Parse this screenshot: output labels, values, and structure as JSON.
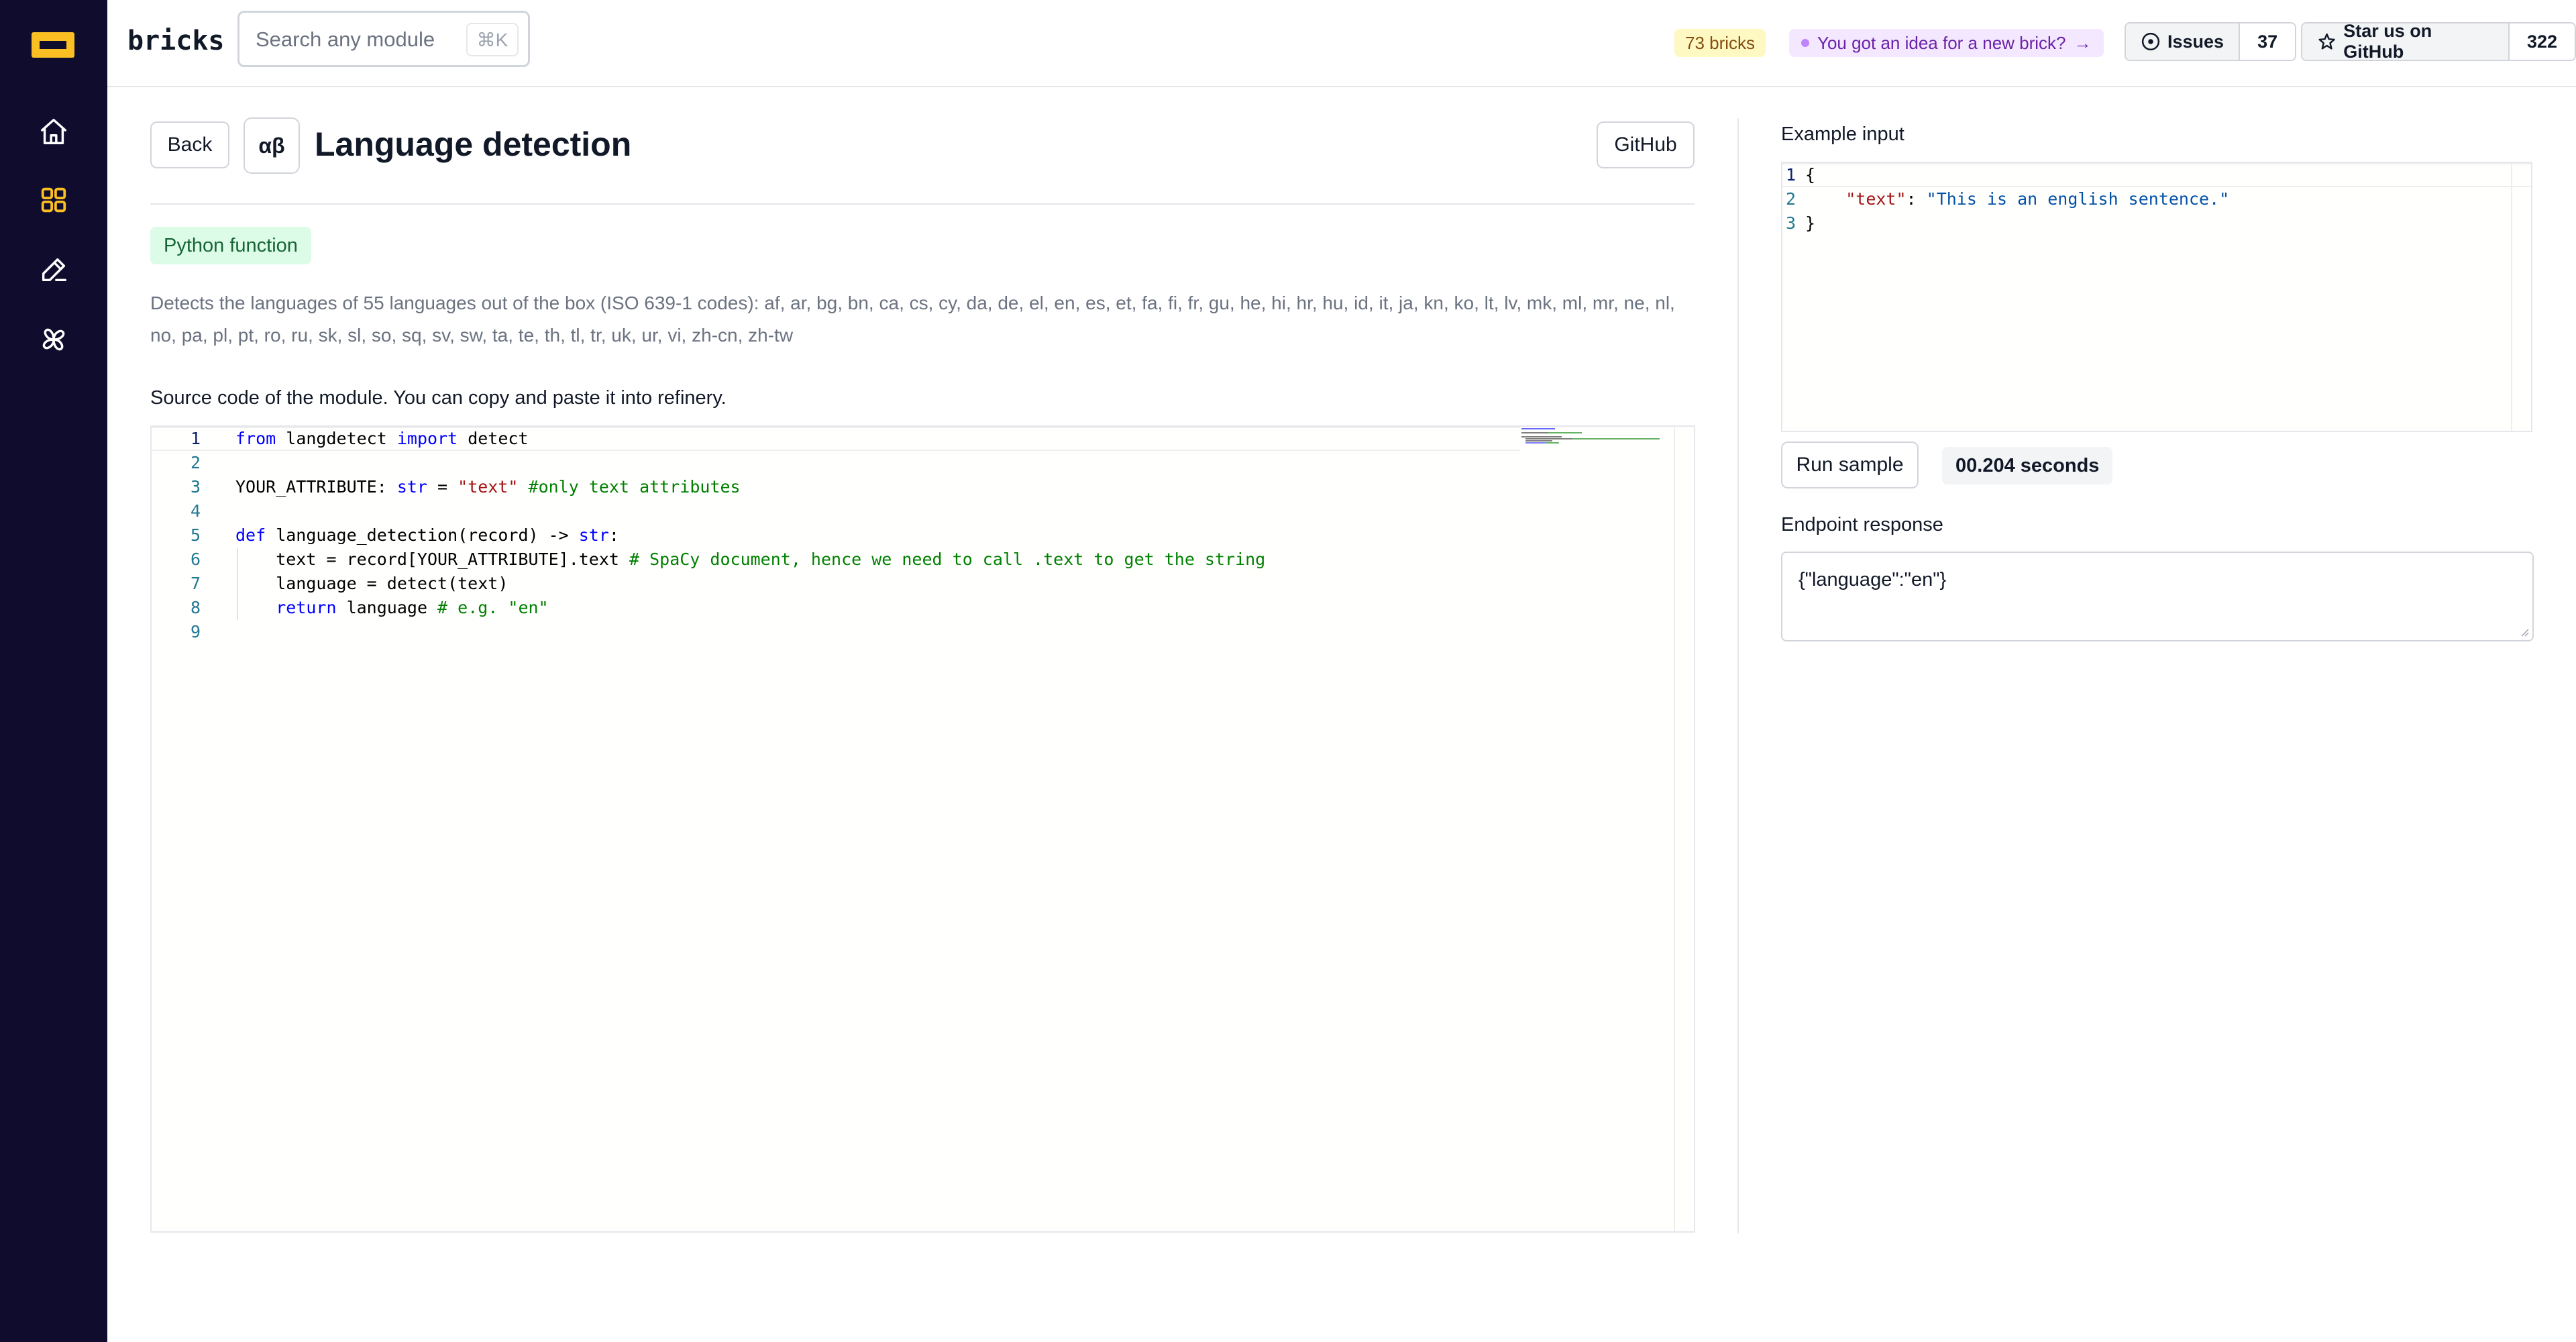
{
  "app": {
    "brand": "bricks",
    "search_placeholder": "Search any module",
    "search_shortcut": "⌘K"
  },
  "topbar": {
    "bricks_count": "73 bricks",
    "idea_text": "You got an idea for a new brick?",
    "idea_arrow": "→",
    "issues_label": "Issues",
    "issues_count": "37",
    "star_label": "Star us on GitHub",
    "star_count": "322"
  },
  "sidebar": {
    "items": [
      {
        "icon": "home-icon"
      },
      {
        "icon": "modules-grid-icon"
      },
      {
        "icon": "pen-edit-icon"
      },
      {
        "icon": "pinwheel-icon"
      }
    ]
  },
  "module": {
    "back_label": "Back",
    "icon_glyph": "αβ",
    "title": "Language detection",
    "github_label": "GitHub",
    "tag": "Python function",
    "description": "Detects the languages of 55 languages out of the box (ISO 639-1 codes): af, ar, bg, bn, ca, cs, cy, da, de, el, en, es, et, fa, fi, fr, gu, he, hi, hr, hu, id, it, ja, kn, ko, lt, lv, mk, ml, mr, ne, nl, no, pa, pl, pt, ro, ru, sk, sl, so, sq, sv, sw, ta, te, th, tl, tr, uk, ur, vi, zh-cn, zh-tw",
    "source_label": "Source code of the module. You can copy and paste it into refinery."
  },
  "code": {
    "lines": [
      {
        "n": "1",
        "t": "from langdetect import detect"
      },
      {
        "n": "2",
        "t": ""
      },
      {
        "n": "3",
        "t": "YOUR_ATTRIBUTE: str = \"text\" #only text attributes"
      },
      {
        "n": "4",
        "t": ""
      },
      {
        "n": "5",
        "t": "def language_detection(record) -> str:"
      },
      {
        "n": "6",
        "t": "    text = record[YOUR_ATTRIBUTE].text # SpaCy document, hence we need to call .text to get the string"
      },
      {
        "n": "7",
        "t": "    language = detect(text)"
      },
      {
        "n": "8",
        "t": "    return language # e.g. \"en\""
      },
      {
        "n": "9",
        "t": ""
      }
    ]
  },
  "example": {
    "label": "Example input",
    "lines": [
      {
        "n": "1",
        "t": "{"
      },
      {
        "n": "2",
        "t": "    \"text\": \"This is an english sentence.\""
      },
      {
        "n": "3",
        "t": "}"
      }
    ],
    "run_label": "Run sample",
    "elapsed": "00.204 seconds",
    "response_label": "Endpoint response",
    "response_value": "{\"language\":\"en\"}"
  },
  "colors": {
    "sidebar_bg": "#0f0c2e",
    "accent": "#fbbf24",
    "keyword": "#0000ff",
    "string": "#a31515",
    "comment": "#008000"
  }
}
